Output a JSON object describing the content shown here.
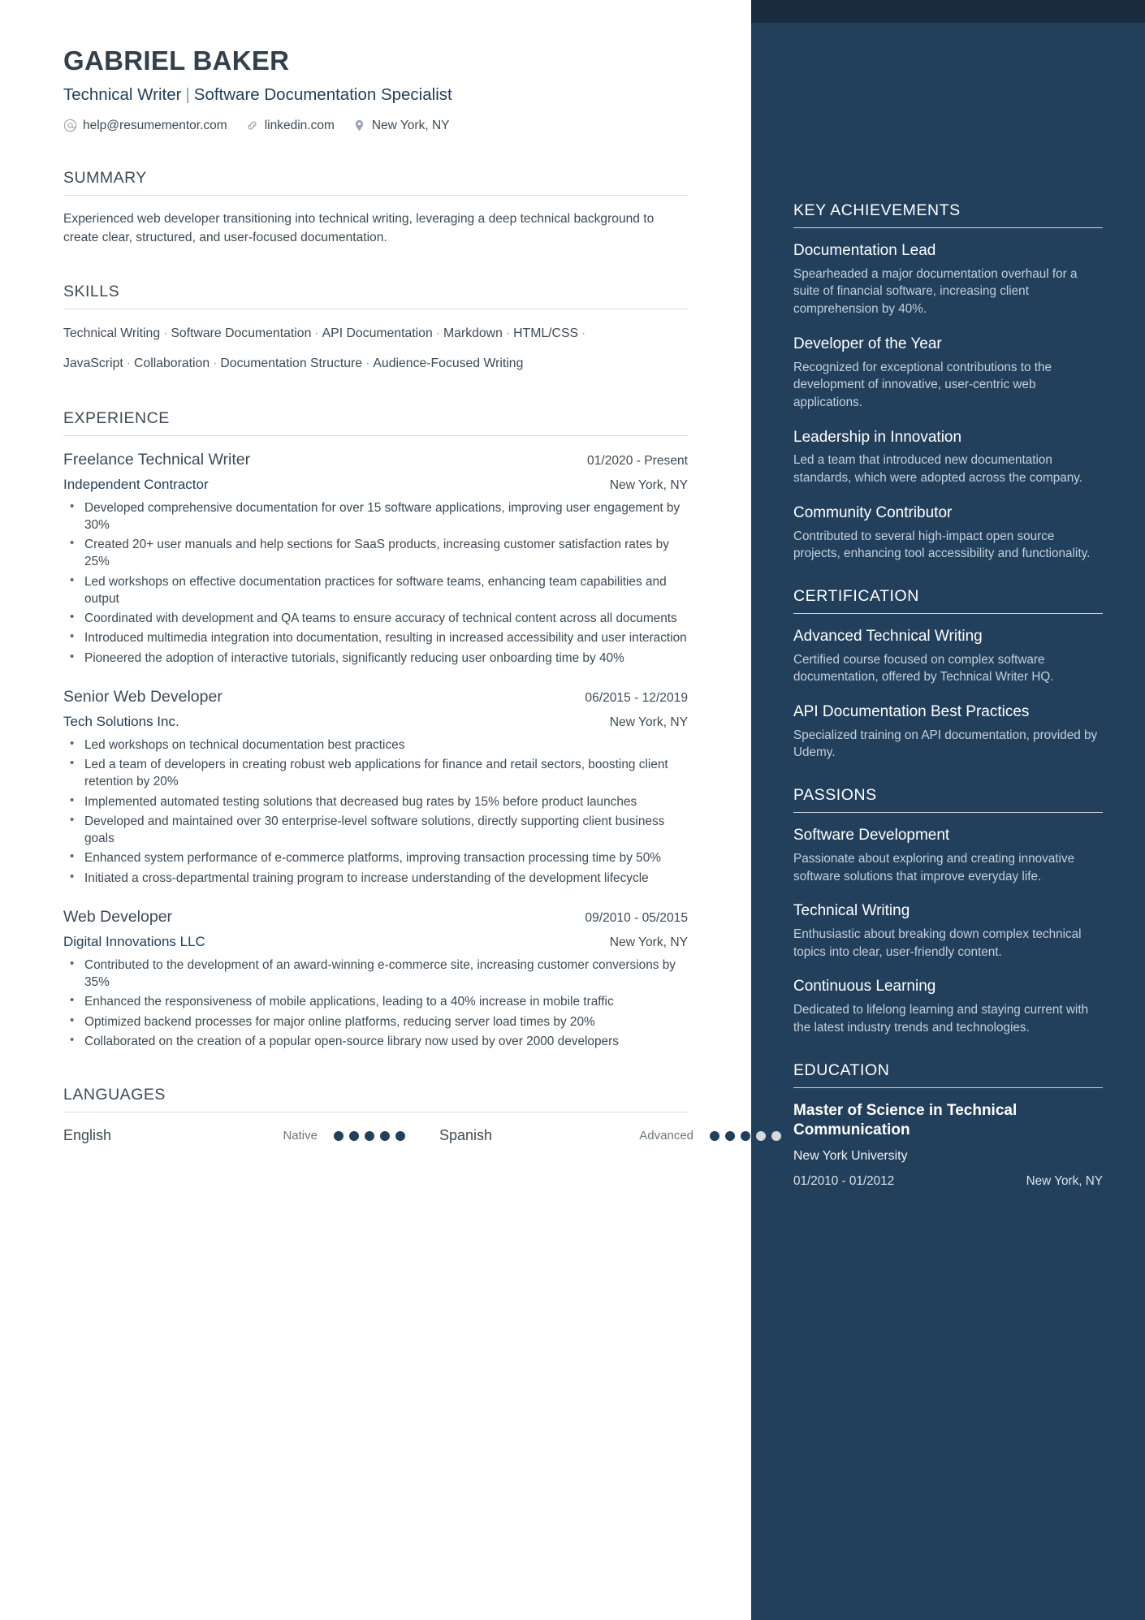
{
  "header": {
    "name": "GABRIEL BAKER",
    "headline_left": "Technical Writer",
    "headline_sep": "|",
    "headline_right": "Software Documentation Specialist",
    "contacts": [
      {
        "icon": "at-icon",
        "text": "help@resumementor.com"
      },
      {
        "icon": "link-icon",
        "text": "linkedin.com"
      },
      {
        "icon": "location-pin-icon",
        "text": "New York, NY"
      }
    ]
  },
  "main": {
    "summary": {
      "heading": "SUMMARY",
      "text": "Experienced web developer transitioning into technical writing, leveraging a deep technical background to create clear, structured, and user-focused documentation."
    },
    "skills": {
      "heading": "SKILLS",
      "line1": [
        "Technical Writing",
        "Software Documentation",
        "API Documentation",
        "Markdown",
        "HTML/CSS"
      ],
      "line2": [
        "JavaScript",
        "Collaboration",
        "Documentation Structure",
        "Audience-Focused Writing"
      ],
      "separator": "·"
    },
    "experience": {
      "heading": "EXPERIENCE",
      "jobs": [
        {
          "title": "Freelance Technical Writer",
          "date": "01/2020 - Present",
          "company": "Independent Contractor",
          "location": "New York, NY",
          "bullets": [
            "Developed comprehensive documentation for over 15 software applications, improving user engagement by 30%",
            "Created 20+ user manuals and help sections for SaaS products, increasing customer satisfaction rates by 25%",
            "Led workshops on effective documentation practices for software teams, enhancing team capabilities and output",
            "Coordinated with development and QA teams to ensure accuracy of technical content across all documents",
            "Introduced multimedia integration into documentation, resulting in increased accessibility and user interaction",
            "Pioneered the adoption of interactive tutorials, significantly reducing user onboarding time by 40%"
          ]
        },
        {
          "title": "Senior Web Developer",
          "date": "06/2015 - 12/2019",
          "company": "Tech Solutions Inc.",
          "location": "New York, NY",
          "bullets": [
            "Led workshops on technical documentation best practices",
            "Led a team of developers in creating robust web applications for finance and retail sectors, boosting client retention by 20%",
            "Implemented automated testing solutions that decreased bug rates by 15% before product launches",
            "Developed and maintained over 30 enterprise-level software solutions, directly supporting client business goals",
            "Enhanced system performance of e-commerce platforms, improving transaction processing time by 50%",
            "Initiated a cross-departmental training program to increase understanding of the development lifecycle"
          ]
        },
        {
          "title": "Web Developer",
          "date": "09/2010 - 05/2015",
          "company": "Digital Innovations LLC",
          "location": "New York, NY",
          "bullets": [
            "Contributed to the development of an award-winning e-commerce site, increasing customer conversions by 35%",
            "Enhanced the responsiveness of mobile applications, leading to a 40% increase in mobile traffic",
            "Optimized backend processes for major online platforms, reducing server load times by 20%",
            "Collaborated on the creation of a popular open-source library now used by over 2000 developers"
          ]
        }
      ]
    },
    "languages": {
      "heading": "LANGUAGES",
      "items": [
        {
          "name": "English",
          "level": "Native",
          "filled": 5,
          "total": 5
        },
        {
          "name": "Spanish",
          "level": "Advanced",
          "filled": 3,
          "total": 5
        }
      ]
    }
  },
  "sidebar": {
    "achievements": {
      "heading": "KEY ACHIEVEMENTS",
      "items": [
        {
          "title": "Documentation Lead",
          "desc": "Spearheaded a major documentation overhaul for a suite of financial software, increasing client comprehension by 40%."
        },
        {
          "title": "Developer of the Year",
          "desc": "Recognized for exceptional contributions to the development of innovative, user-centric web applications."
        },
        {
          "title": "Leadership in Innovation",
          "desc": "Led a team that introduced new documentation standards, which were adopted across the company."
        },
        {
          "title": "Community Contributor",
          "desc": "Contributed to several high-impact open source projects, enhancing tool accessibility and functionality."
        }
      ]
    },
    "certification": {
      "heading": "CERTIFICATION",
      "items": [
        {
          "title": "Advanced Technical Writing",
          "desc": "Certified course focused on complex software documentation, offered by Technical Writer HQ."
        },
        {
          "title": "API Documentation Best Practices",
          "desc": "Specialized training on API documentation, provided by Udemy."
        }
      ]
    },
    "passions": {
      "heading": "PASSIONS",
      "items": [
        {
          "title": "Software Development",
          "desc": "Passionate about exploring and creating innovative software solutions that improve everyday life."
        },
        {
          "title": "Technical Writing",
          "desc": "Enthusiastic about breaking down complex technical topics into clear, user-friendly content."
        },
        {
          "title": "Continuous Learning",
          "desc": "Dedicated to lifelong learning and staying current with the latest industry trends and technologies."
        }
      ]
    },
    "education": {
      "heading": "EDUCATION",
      "degree": "Master of Science in Technical Communication",
      "school": "New York University",
      "date": "01/2010 - 01/2012",
      "location": "New York, NY"
    }
  },
  "colors": {
    "sidebar_bg": "#22405c",
    "sidebar_top_band": "#1a2c40",
    "accent_text": "#22405c",
    "body_text": "#3d4a55"
  }
}
